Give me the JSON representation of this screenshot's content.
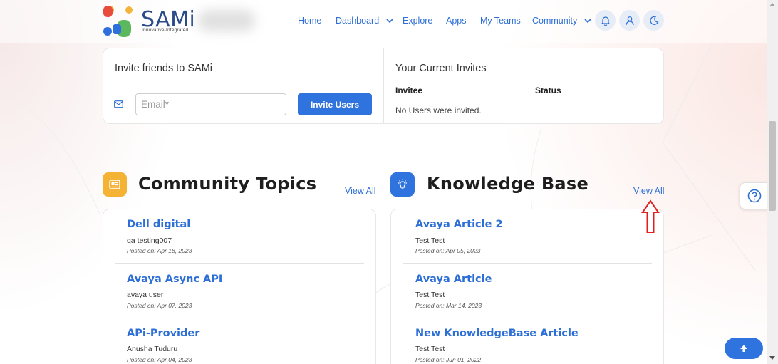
{
  "colors": {
    "accent": "#2f73de",
    "link": "#2d6fd6",
    "topics_icon": "#f5b335",
    "kb_icon": "#2f73de",
    "annotation": "#e02020"
  },
  "brand": {
    "name": "SAMi",
    "tagline": "Innovative-Integrated"
  },
  "nav": {
    "home": "Home",
    "dashboard": "Dashboard",
    "explore": "Explore",
    "apps": "Apps",
    "my_teams": "My Teams",
    "community": "Community",
    "icons": [
      "bell-icon",
      "user-icon",
      "moon-icon"
    ]
  },
  "invite": {
    "title": "Invite friends to SAMi",
    "email_placeholder": "Email*",
    "email_value": "",
    "button": "Invite Users"
  },
  "current_invites": {
    "title": "Your Current Invites",
    "columns": [
      "Invitee",
      "Status"
    ],
    "empty_text": "No Users were invited."
  },
  "community_topics": {
    "title": "Community Topics",
    "view_all": "View All",
    "items": [
      {
        "title": "Dell digital",
        "author": "qa testing007",
        "date": "Posted on: Apr 18, 2023"
      },
      {
        "title": "Avaya Async API",
        "author": "avaya user",
        "date": "Posted on: Apr 07, 2023"
      },
      {
        "title": "APi-Provider",
        "author": "Anusha Tuduru",
        "date": "Posted on: Apr 04, 2023"
      }
    ]
  },
  "knowledge_base": {
    "title": "Knowledge Base",
    "view_all": "View All",
    "items": [
      {
        "title": "Avaya Article 2",
        "author": "Test Test",
        "date": "Posted on: Apr 05, 2023"
      },
      {
        "title": "Avaya Article",
        "author": "Test Test",
        "date": "Posted on: Mar 14, 2023"
      },
      {
        "title": "New KnowledgeBase Article",
        "author": "Test Test",
        "date": "Posted on: Jun 01, 2022"
      }
    ]
  }
}
